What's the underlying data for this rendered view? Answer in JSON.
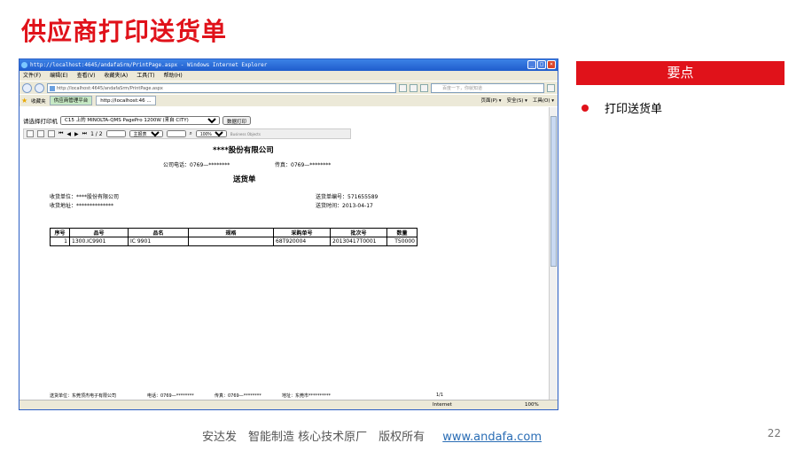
{
  "slide": {
    "title": "供应商打印送货单",
    "key_header": "要点",
    "key_item": "打印送货单",
    "footer_text": "安达发　智能制造 核心技术原厂　版权所有",
    "footer_link": "www.andafa.com",
    "page_number": "22"
  },
  "browser": {
    "title": "http://localhost:4645/andafaSrm/PrintPage.aspx - Windows Internet Explorer",
    "menu": [
      "文件(F)",
      "编辑(E)",
      "查看(V)",
      "收藏夹(A)",
      "工具(T)",
      "帮助(H)"
    ],
    "address": "http://localhost:4645/andafaSrm/PrintPage.aspx",
    "search_placeholder": "百度一下，你就知道",
    "favorites_label": "收藏夹",
    "tabs": [
      "供应商管理平台",
      "http://localhost:46 ..."
    ],
    "tools": [
      "页面(P) ▾",
      "安全(S) ▾",
      "工具(O) ▾"
    ],
    "status_zone": "Internet",
    "zoom": "100%"
  },
  "print": {
    "printer_label": "请选择打印机",
    "printer_value": "C15 上的 MINOLTA-QMS PagePro 1200W (来自 CITY)",
    "print_button": "数据打印",
    "page_indicator": "1 / 2",
    "view_mode": "主报表",
    "zoom": "100%",
    "bo_label": "Business Objects"
  },
  "report": {
    "company": "****股份有限公司",
    "phone": "公司电话：0769—********",
    "fax": "传真：0769—********",
    "doc_title": "送货单",
    "receiver_unit": "收货单位：****股份有限公司",
    "receiver_address": "收货地址：**************",
    "delivery_no": "送货单编号：571655589",
    "delivery_time": "送货时间：2013-04-17",
    "columns": [
      "序号",
      "品号",
      "品名",
      "规格",
      "采购单号",
      "批次号",
      "数量"
    ],
    "rows": [
      [
        "1",
        "1300.IC9901",
        "IC 9901",
        "",
        "68T920004",
        "20130417T0001",
        "T50000"
      ]
    ],
    "footer": {
      "sender": "送货单位：东莞顶杰电子有限公司",
      "phone": "电话：0769—********",
      "fax": "传真：0769—********",
      "address": "地址：东莞市**********",
      "page": "1/1"
    }
  }
}
